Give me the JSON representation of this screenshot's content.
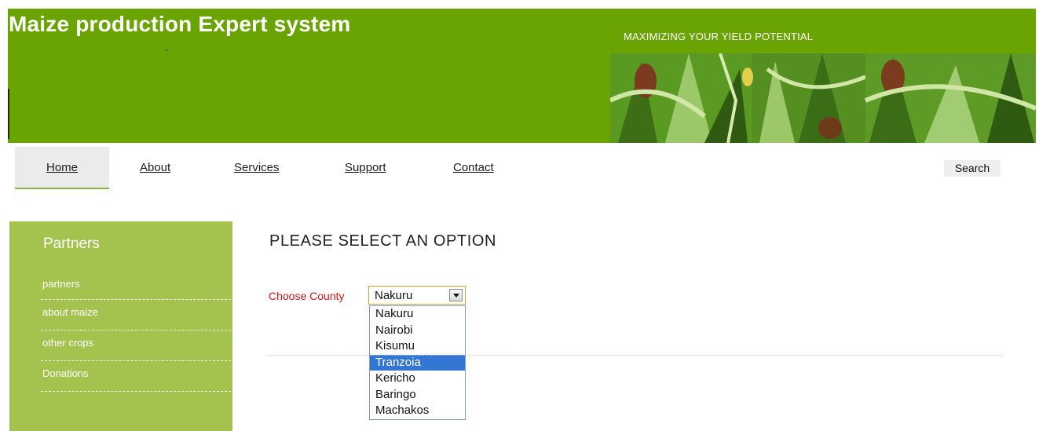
{
  "header": {
    "title": "Maize production Expert system",
    "tagline": "MAXIMIZING YOUR YIELD POTENTIAL",
    "colors": {
      "header_green": "#6aa403",
      "sidebar_green": "#a4c34e",
      "label_red": "#c8161c",
      "highlight_blue": "#3376d4"
    }
  },
  "nav": {
    "items": [
      {
        "label": "Home",
        "active": true
      },
      {
        "label": "About"
      },
      {
        "label": "Services"
      },
      {
        "label": "Support"
      },
      {
        "label": "Contact"
      }
    ],
    "search_label": "Search"
  },
  "sidebar": {
    "title": "Partners",
    "links": [
      "partners",
      "about maize",
      "other crops",
      "Donations"
    ]
  },
  "main": {
    "heading": "PLEASE SELECT AN OPTION",
    "county_label": "Choose County",
    "selected_county": "Nakuru",
    "county_options": [
      "Nakuru",
      "Nairobi",
      "Kisumu",
      "Tranzoia",
      "Kericho",
      "Baringo",
      "Machakos"
    ],
    "highlighted_option": "Tranzoia"
  }
}
